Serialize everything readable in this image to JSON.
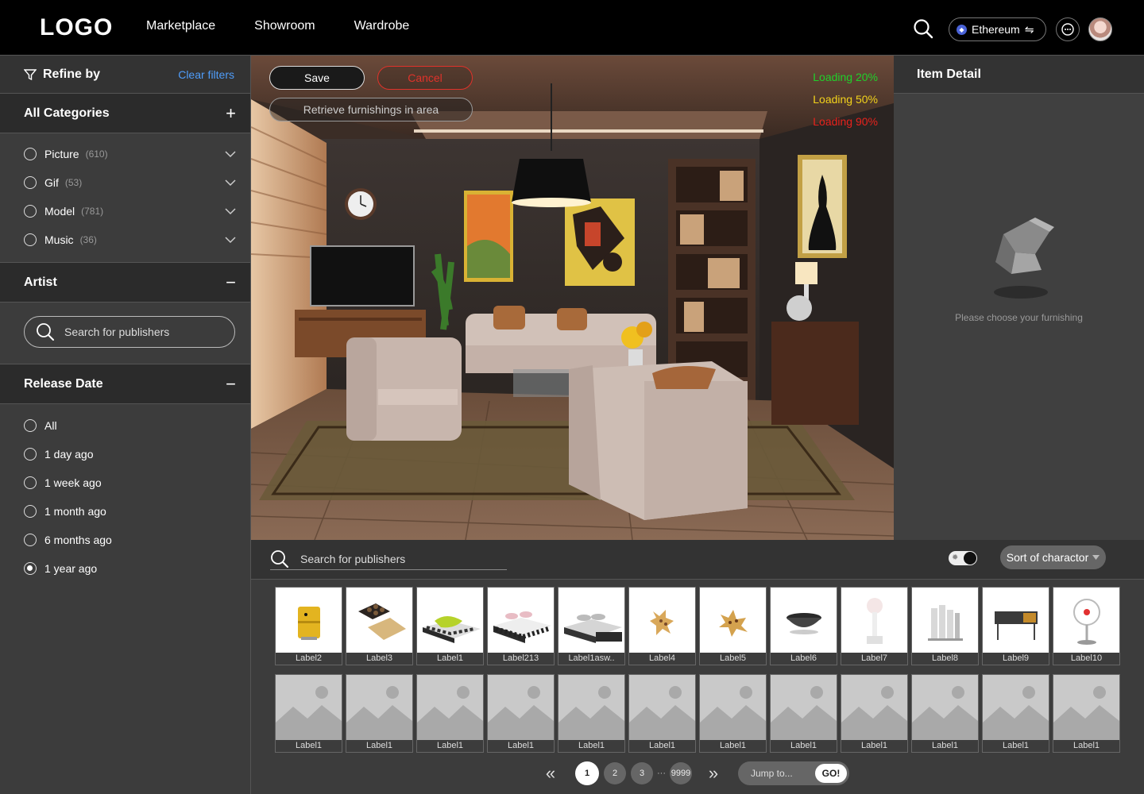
{
  "header": {
    "logo": "LOGO",
    "nav": [
      "Marketplace",
      "Showroom",
      "Wardrobe"
    ],
    "network": "Ethereum",
    "network_swap": "⇋"
  },
  "sidebar": {
    "refine_label": "Refine by",
    "clear_label": "Clear filters",
    "categories_title": "All Categories",
    "categories_ctrl": "+",
    "categories": [
      {
        "label": "Picture",
        "count": "(610)"
      },
      {
        "label": "Gif",
        "count": "(53)"
      },
      {
        "label": "Model",
        "count": "(781)"
      },
      {
        "label": "Music",
        "count": "(36)"
      }
    ],
    "artist_title": "Artist",
    "artist_ctrl": "−",
    "artist_search_placeholder": "Search for publishers",
    "release_title": "Release Date",
    "release_ctrl": "−",
    "release_options": [
      "All",
      "1 day ago",
      "1 week ago",
      "1 month ago",
      "6 months ago",
      "1 year ago"
    ],
    "release_selected": "1 year ago"
  },
  "scene": {
    "save_label": "Save",
    "cancel_label": "Cancel",
    "retrieve_label": "Retrieve furnishings in area",
    "loading": [
      {
        "label": "Loading 20%",
        "color": "#1fd12a"
      },
      {
        "label": "Loading 50%",
        "color": "#f2d21b"
      },
      {
        "label": "Loading 90%",
        "color": "#e8221c"
      }
    ]
  },
  "detail": {
    "title": "Item Detail",
    "empty_message": "Please choose your furnishing"
  },
  "toolbar": {
    "search_placeholder": "Search for publishers",
    "sort_label": "Sort of charactor"
  },
  "grid": {
    "row1": [
      {
        "label": "Label2",
        "icon": "yellow-cabinet-icon"
      },
      {
        "label": "Label3",
        "icon": "tray-icon"
      },
      {
        "label": "Label1",
        "icon": "bed-icon"
      },
      {
        "label": "Label213",
        "icon": "bed-icon"
      },
      {
        "label": "Label1asw..",
        "icon": "bed-icon"
      },
      {
        "label": "Label4",
        "icon": "rug-icon"
      },
      {
        "label": "Label5",
        "icon": "rug-icon"
      },
      {
        "label": "Label6",
        "icon": "bowl-icon"
      },
      {
        "label": "Label7",
        "icon": "lamp-icon"
      },
      {
        "label": "Label8",
        "icon": "book-stand-icon"
      },
      {
        "label": "Label9",
        "icon": "console-table-icon"
      },
      {
        "label": "Label10",
        "icon": "fan-icon"
      }
    ],
    "row2": [
      "Label1",
      "Label1",
      "Label1",
      "Label1",
      "Label1",
      "Label1",
      "Label1",
      "Label1",
      "Label1",
      "Label1",
      "Label1",
      "Label1"
    ]
  },
  "pager": {
    "first": "«",
    "last": "»",
    "pages": [
      "1",
      "2",
      "3"
    ],
    "ellipsis": "···",
    "last_page": "9999",
    "current": "1",
    "jump_placeholder": "Jump to...",
    "go_label": "GO!"
  }
}
